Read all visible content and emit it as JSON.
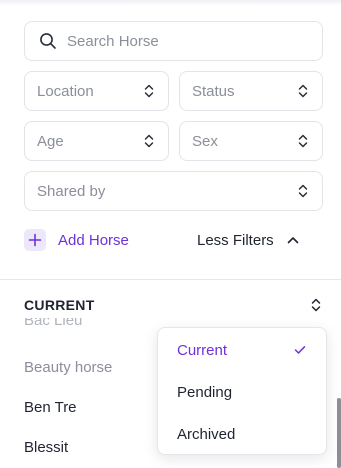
{
  "filters": {
    "search": {
      "placeholder": "Search Horse"
    },
    "location": {
      "label": "Location"
    },
    "status": {
      "label": "Status"
    },
    "age": {
      "label": "Age"
    },
    "sex": {
      "label": "Sex"
    },
    "shared_by": {
      "label": "Shared by"
    }
  },
  "actions": {
    "add_horse": "Add Horse",
    "less_filters": "Less Filters"
  },
  "list": {
    "header": "CURRENT",
    "items": [
      "Bac Lieu",
      "Beauty horse",
      "Ben Tre",
      "Blessit"
    ]
  },
  "dropdown": {
    "options": [
      "Current",
      "Pending",
      "Archived"
    ],
    "selected": "Current"
  },
  "colors": {
    "accent": "#6d32d9",
    "accent_bg": "#ede7fb",
    "border": "#e2e4e9",
    "placeholder_text": "#8a8f99",
    "text": "#1f2430"
  },
  "icons": {
    "search": "search-icon",
    "select": "chevron-up-down-icon",
    "add": "plus-icon",
    "collapse": "chevron-up-icon",
    "selected": "check-icon"
  }
}
